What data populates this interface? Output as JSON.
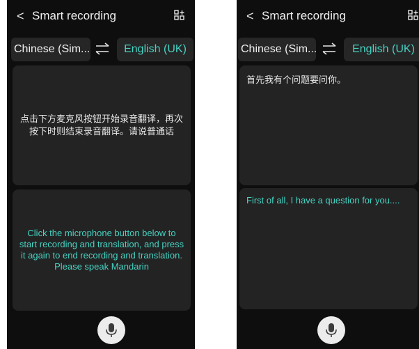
{
  "left_screen": {
    "header": {
      "title": "Smart recording",
      "back_icon": "chevron-left-icon",
      "menu_icon": "grid-add-icon"
    },
    "languages": {
      "source": "Chinese (Sim...",
      "target": "English (UK)",
      "swap_icon": "swap-arrows-icon"
    },
    "source_panel": {
      "text": "点击下方麦克风按钮开始录音翻译，再次按下时则结束录音翻译。请说普通话"
    },
    "target_panel": {
      "text": "Click the microphone button below to start recording and translation, and press it again to end recording and translation. Please speak Mandarin"
    },
    "mic": {
      "icon": "microphone-icon"
    }
  },
  "right_screen": {
    "header": {
      "title": "Smart recording",
      "back_icon": "chevron-left-icon",
      "menu_icon": "grid-add-icon"
    },
    "languages": {
      "source": "Chinese (Sim...",
      "target": "English (UK)",
      "swap_icon": "swap-arrows-icon"
    },
    "source_panel": {
      "text": "首先我有个问题要问你。"
    },
    "target_panel": {
      "text": "First of all, I have a question for you...."
    },
    "mic": {
      "icon": "microphone-icon"
    }
  },
  "colors": {
    "background": "#0e0e0e",
    "panel": "#232323",
    "accent": "#46d3c3",
    "text": "#e8e8e8"
  },
  "back_glyph": "<"
}
